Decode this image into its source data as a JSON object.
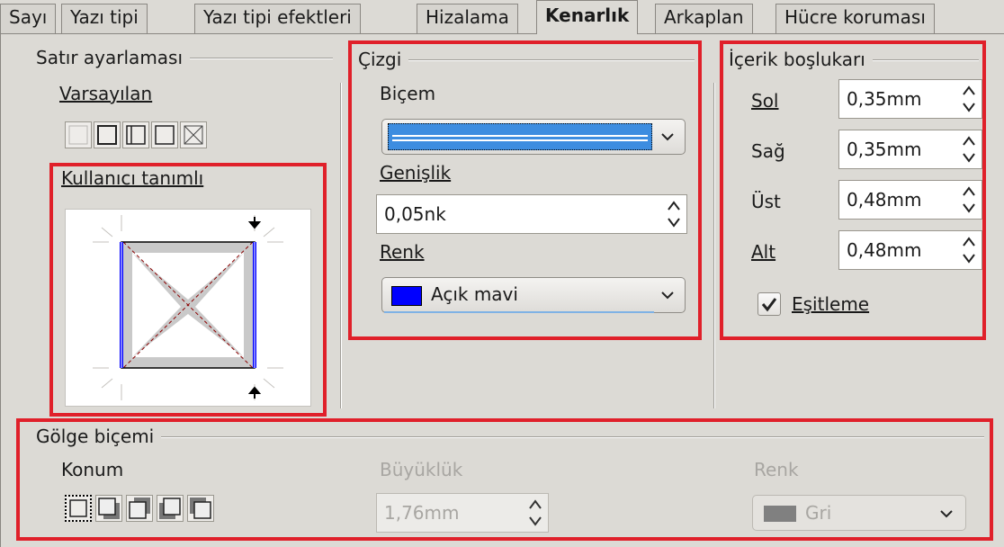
{
  "tabs": [
    "Sayı",
    "Yazı tipi",
    "Yazı tipi efektleri",
    "Hizalama",
    "Kenarlık",
    "Arkaplan",
    "Hücre koruması"
  ],
  "line_arrangement": {
    "title": "Satır ayarlaması",
    "default_label": "Varsayılan",
    "user_defined_label": "Kullanıcı tanımlı"
  },
  "line": {
    "title": "Çizgi",
    "style_label": "Biçem",
    "width_label": "Genişlik",
    "width_value": "0,05nk",
    "color_label": "Renk",
    "color_value": "Açık mavi",
    "color_swatch": "#0000ff",
    "line_color": "#2f6fd6"
  },
  "spacing": {
    "title": "İçerik boşlukarı",
    "left_label": "Sol",
    "left_value": "0,35mm",
    "right_label": "Sağ",
    "right_value": "0,35mm",
    "top_label": "Üst",
    "top_value": "0,48mm",
    "bottom_label": "Alt",
    "bottom_value": "0,48mm",
    "sync_label": "Eşitleme",
    "sync_checked": true
  },
  "shadow": {
    "title": "Gölge biçemi",
    "position_label": "Konum",
    "size_label": "Büyüklük",
    "size_value": "1,76mm",
    "color_label": "Renk",
    "color_value": "Gri",
    "color_swatch": "#808080"
  },
  "colors": {
    "highlight": "#e0202a",
    "accent_blue": "#0000ff"
  }
}
